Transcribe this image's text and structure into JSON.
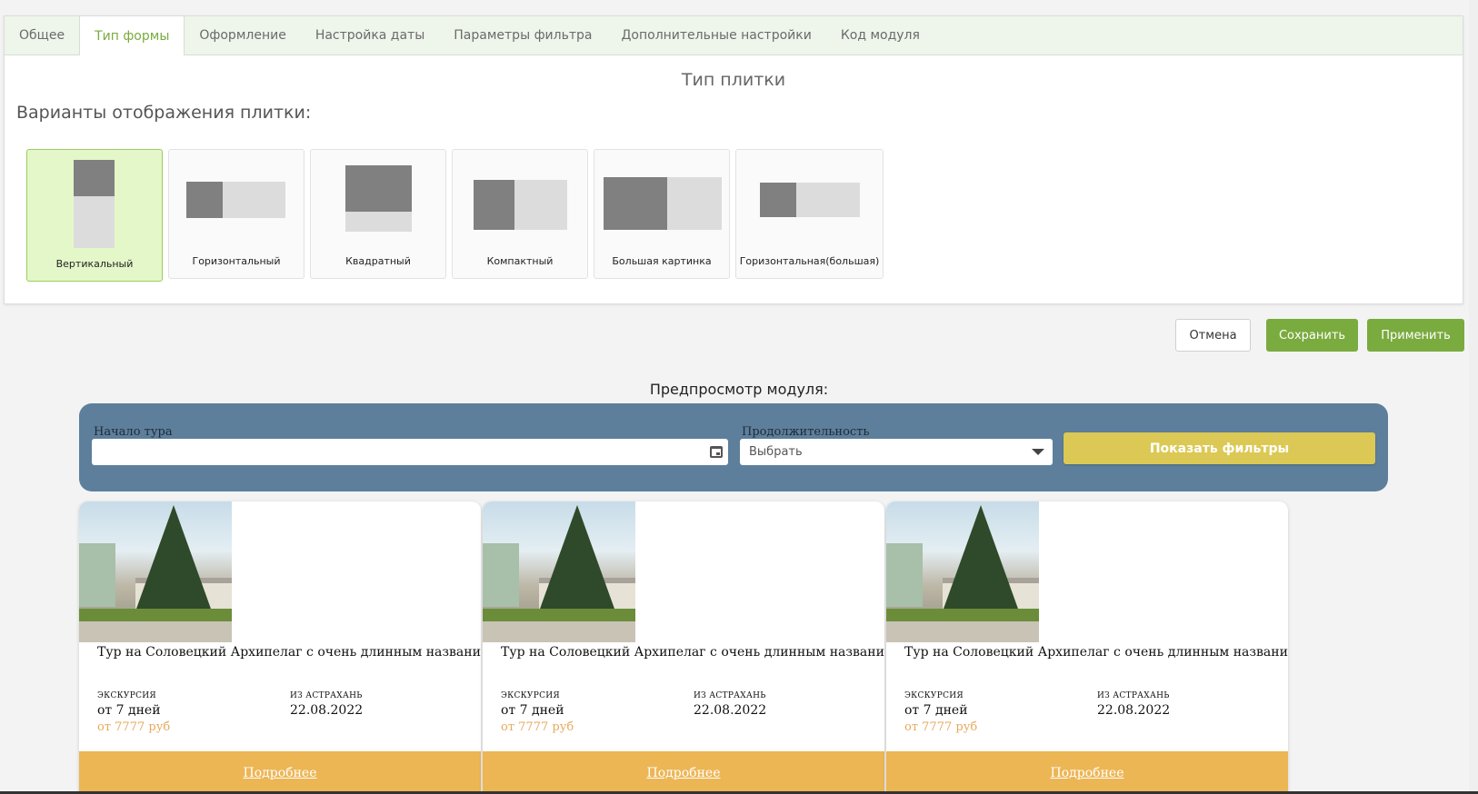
{
  "tabs": [
    {
      "label": "Общее"
    },
    {
      "label": "Тип формы"
    },
    {
      "label": "Оформление"
    },
    {
      "label": "Настройка даты"
    },
    {
      "label": "Параметры фильтра"
    },
    {
      "label": "Дополнительные настройки"
    },
    {
      "label": "Код модуля"
    }
  ],
  "active_tab": "Тип формы",
  "panel": {
    "title": "Тип плитки",
    "variants_label": "Варианты отображения плитки:",
    "tiles": [
      {
        "label": "Вертикальный",
        "selected": true
      },
      {
        "label": "Горизонтальный"
      },
      {
        "label": "Квадратный"
      },
      {
        "label": "Компактный"
      },
      {
        "label": "Большая картинка"
      },
      {
        "label": "Горизонтальная(большая)"
      }
    ]
  },
  "actions": {
    "cancel": "Отмена",
    "save": "Сохранить",
    "apply": "Применить"
  },
  "preview": {
    "title": "Предпросмотр модуля:",
    "filter": {
      "start_label": "Начало тура",
      "start_value": "",
      "duration_label": "Продолжительность",
      "duration_value": "Выбрать",
      "show_filters": "Показать фильтры"
    },
    "cards": [
      {
        "title": "Тур на Соловецкий Архипелаг с очень длинным названием",
        "type": "ЭКСКУРСИЯ",
        "duration": "от 7 дней",
        "from_label": "ИЗ АСТРАХАНЬ",
        "date": "22.08.2022",
        "price": "от 7777 руб",
        "more": "Подробнее"
      },
      {
        "title": "Тур на Соловецкий Архипелаг с очень длинным названием",
        "type": "ЭКСКУРСИЯ",
        "duration": "от 7 дней",
        "from_label": "ИЗ АСТРАХАНЬ",
        "date": "22.08.2022",
        "price": "от 7777 руб",
        "more": "Подробнее"
      },
      {
        "title": "Тур на Соловецкий Архипелаг с очень длинным названием",
        "type": "ЭКСКУРСИЯ",
        "duration": "от 7 дней",
        "from_label": "ИЗ АСТРАХАНЬ",
        "date": "22.08.2022",
        "price": "от 7777 руб",
        "more": "Подробнее"
      }
    ]
  },
  "colors": {
    "accent_green": "#7aab3f",
    "filter_bg": "#5d7f9c",
    "filter_button": "#dcc955",
    "card_footer": "#ecb655",
    "price": "#e7a95e"
  }
}
